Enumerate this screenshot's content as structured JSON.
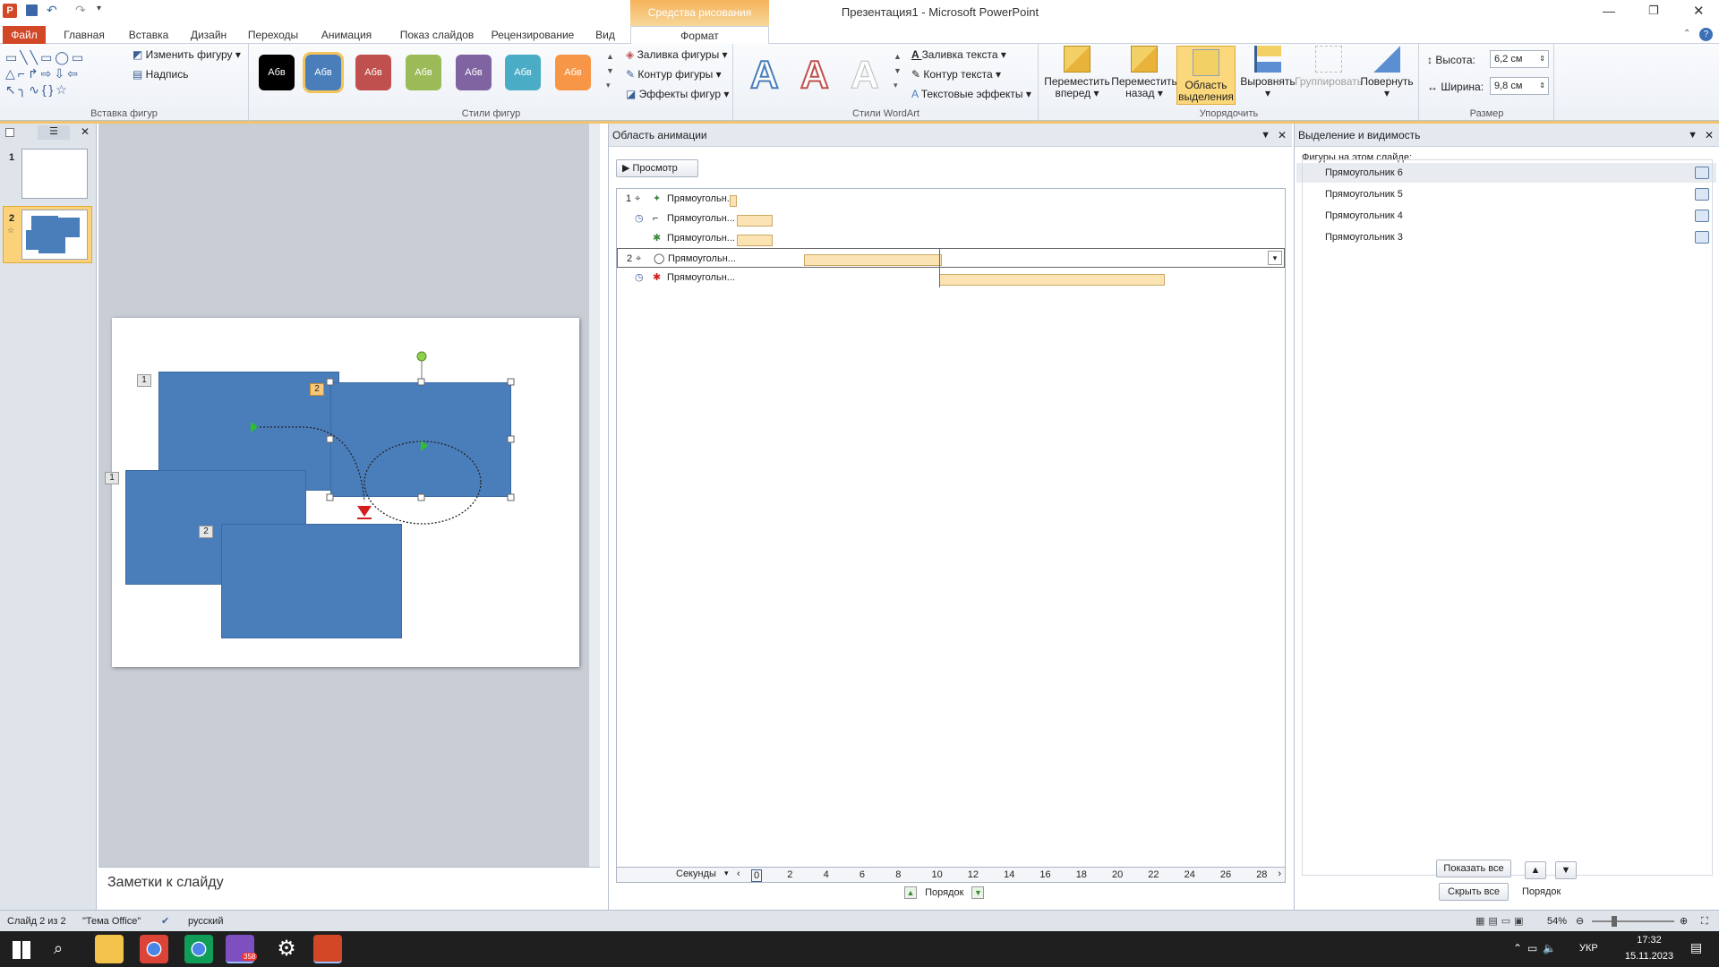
{
  "window": {
    "title": "Презентация1 - Microsoft PowerPoint",
    "context_tab": "Средства рисования"
  },
  "ribbon_tabs": [
    "Файл",
    "Главная",
    "Вставка",
    "Дизайн",
    "Переходы",
    "Анимация",
    "Показ слайдов",
    "Рецензирование",
    "Вид",
    "Формат"
  ],
  "ribbon": {
    "insert_shapes": {
      "change_shape": "Изменить фигуру",
      "textbox": "Надпись",
      "label": "Вставка фигур"
    },
    "shape_styles": {
      "swatch_text": "Абв",
      "label": "Стили фигур",
      "fill": "Заливка фигуры",
      "outline": "Контур фигуры",
      "effects": "Эффекты фигур"
    },
    "wordart": {
      "label": "Стили WordArt",
      "text_fill": "Заливка текста",
      "text_outline": "Контур текста",
      "text_effects": "Текстовые эффекты"
    },
    "arrange": {
      "label": "Упорядочить",
      "forward": "Переместить вперед",
      "backward": "Переместить назад",
      "selection_pane": "Область выделения",
      "align": "Выровнять",
      "group": "Группировать",
      "rotate": "Повернуть"
    },
    "size": {
      "label": "Размер",
      "height_label": "Высота:",
      "height": "6,2 см",
      "width_label": "Ширина:",
      "width": "9,8 см"
    }
  },
  "slides_panel": {
    "slide_numbers": [
      "1",
      "2"
    ]
  },
  "slide_badges": {
    "a": "1",
    "b": "2",
    "c": "1",
    "d": "2"
  },
  "notes": {
    "placeholder": "Заметки к слайду"
  },
  "animation_pane": {
    "title": "Область анимации",
    "play_label": "Просмотр",
    "items": [
      {
        "num": "1",
        "name": "Прямоугольн..."
      },
      {
        "num": "",
        "name": "Прямоугольн..."
      },
      {
        "num": "",
        "name": "Прямоугольн..."
      },
      {
        "num": "2",
        "name": "Прямоугольн..."
      },
      {
        "num": "",
        "name": "Прямоугольн..."
      }
    ],
    "timeline_label": "Секунды",
    "ticks": [
      "0",
      "2",
      "4",
      "6",
      "8",
      "10",
      "12",
      "14",
      "16",
      "18",
      "20",
      "22",
      "24",
      "26",
      "28"
    ],
    "order_label": "Порядок"
  },
  "selection_pane": {
    "title": "Выделение и видимость",
    "subtitle": "Фигуры на этом слайде:",
    "items": [
      "Прямоугольник 6",
      "Прямоугольник 5",
      "Прямоугольник 4",
      "Прямоугольник 3"
    ],
    "show_all": "Показать все",
    "hide_all": "Скрыть все",
    "order_label": "Порядок"
  },
  "status": {
    "slide": "Слайд 2 из 2",
    "theme": "\"Тема Office\"",
    "language": "русский",
    "zoom": "54%"
  },
  "taskbar": {
    "lang": "УКР",
    "time": "17:32",
    "date": "15.11.2023",
    "badge": "358"
  }
}
